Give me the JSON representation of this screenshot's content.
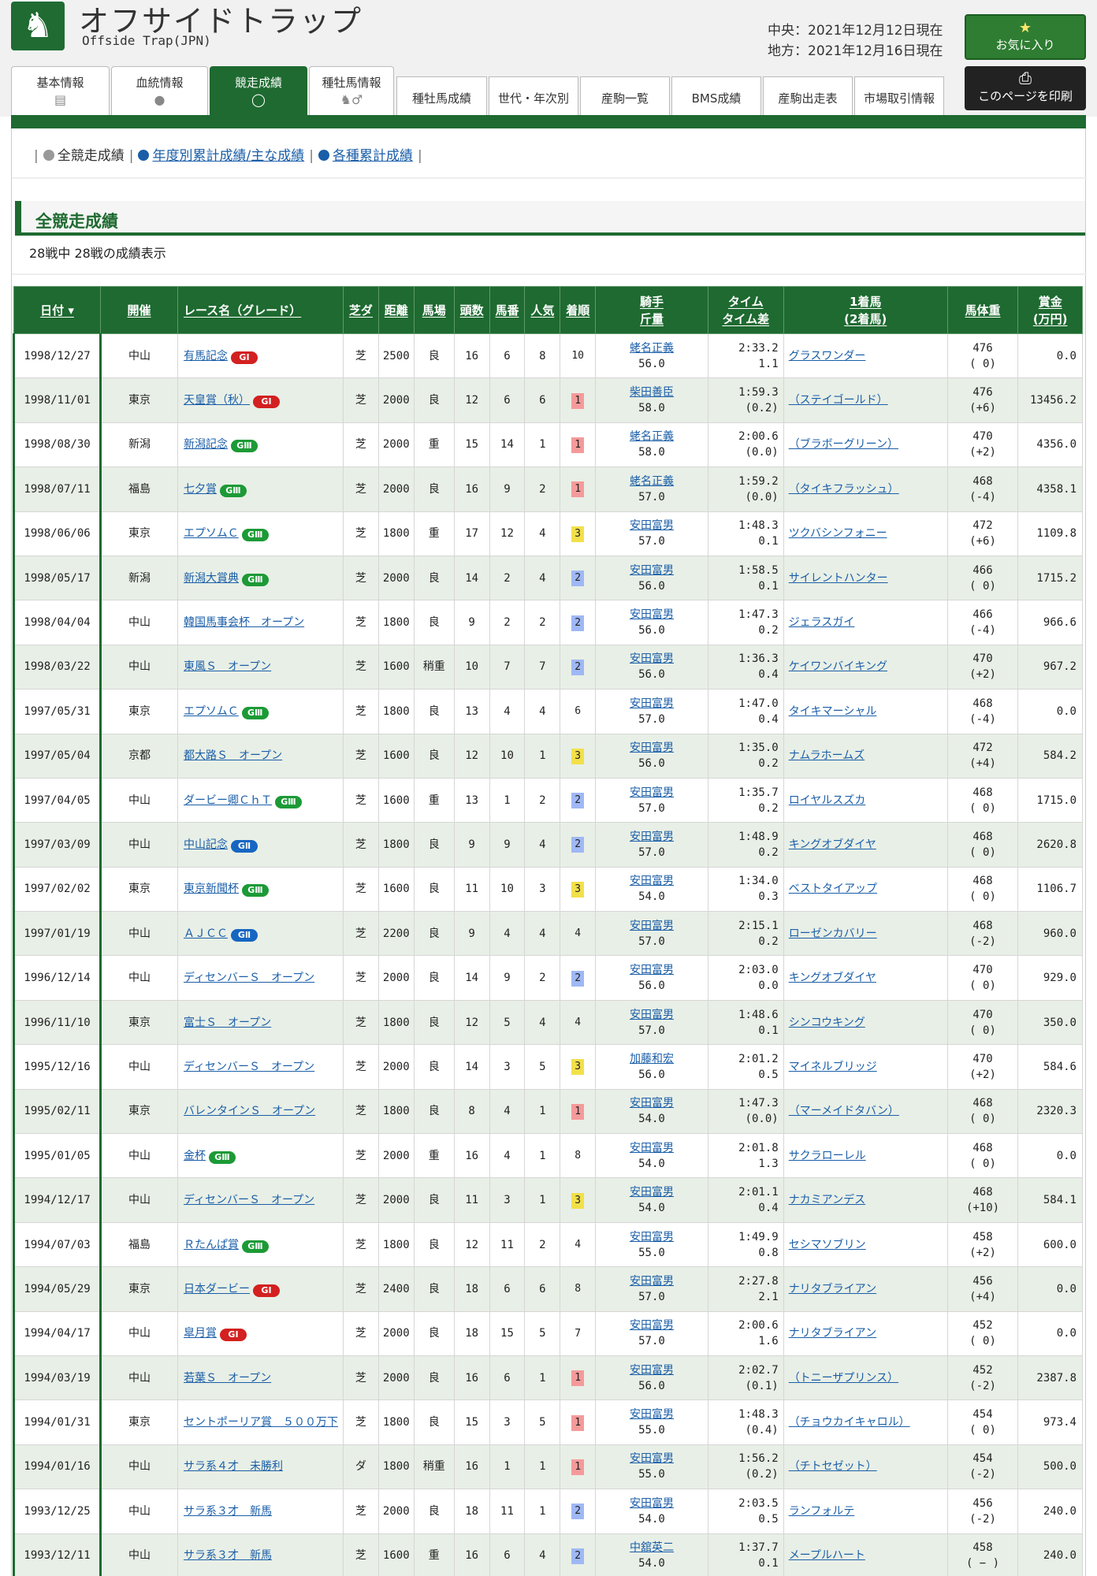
{
  "site": {
    "title": "オフサイドトラップ",
    "subtitle": "Offside Trap(JPN)",
    "date_central": "中央：2021年12月12日現在",
    "date_local": "地方：2021年12月16日現在",
    "fav_label": "お気に入り",
    "print_label": "このページを印刷",
    "logo_icon": "horse-icon"
  },
  "tabs": [
    {
      "label": "基本情報",
      "icon": "document-icon"
    },
    {
      "label": "血統情報",
      "icon": "drop-icon"
    },
    {
      "label": "競走成績",
      "icon": "horseshoe-icon",
      "active": true
    },
    {
      "label": "種牡馬情報",
      "icon": "horse-male-icon"
    }
  ],
  "subtabs": [
    "種牡馬成績",
    "世代・年次別",
    "産駒一覧",
    "BMS成績",
    "産駒出走表",
    "市場取引情報"
  ],
  "nav": {
    "current": "全競走成績",
    "link1": "年度別累計成績/主な成績",
    "link2": "各種累計成績"
  },
  "section": {
    "title": "全競走成績",
    "count": "28戦中 28戦の成績表示"
  },
  "columns": {
    "date": "日付",
    "venue": "開催",
    "race": "レース名（グレード）",
    "surface": "芝ダ",
    "distance": "距離",
    "going": "馬場",
    "runners": "頭数",
    "gate": "馬番",
    "pop": "人気",
    "place": "着順",
    "jockey1": "騎手",
    "jockey2": "斤量",
    "time1": "タイム",
    "time2": "タイム差",
    "winner1": "1着馬",
    "winner2": "(2着馬)",
    "weight": "馬体重",
    "prize1": "賞金",
    "prize2": "(万円)"
  },
  "rows": [
    {
      "date": "1998/12/27",
      "venue": "中山",
      "race": "有馬記念",
      "grade": "G1",
      "surface": "芝",
      "distance": "2500",
      "going": "良",
      "runners": "16",
      "gate": "6",
      "pop": "8",
      "place": "10",
      "jockey": "蛯名正義",
      "kinryo": "56.0",
      "time": "2:33.2",
      "diff": "1.1",
      "winner": "グラスワンダー",
      "bw": "476",
      "bwd": "( 0)",
      "prize": "0.0"
    },
    {
      "date": "1998/11/01",
      "venue": "東京",
      "race": "天皇賞（秋）",
      "grade": "G1",
      "surface": "芝",
      "distance": "2000",
      "going": "良",
      "runners": "12",
      "gate": "6",
      "pop": "6",
      "place": "1",
      "jockey": "柴田善臣",
      "kinryo": "58.0",
      "time": "1:59.3",
      "diff": "(0.2)",
      "winner": "（ステイゴールド）",
      "bw": "476",
      "bwd": "(+6)",
      "prize": "13456.2"
    },
    {
      "date": "1998/08/30",
      "venue": "新潟",
      "race": "新潟記念",
      "grade": "G3",
      "surface": "芝",
      "distance": "2000",
      "going": "重",
      "runners": "15",
      "gate": "14",
      "pop": "1",
      "place": "1",
      "jockey": "蛯名正義",
      "kinryo": "58.0",
      "time": "2:00.6",
      "diff": "(0.0)",
      "winner": "（ブラボーグリーン）",
      "bw": "470",
      "bwd": "(+2)",
      "prize": "4356.0"
    },
    {
      "date": "1998/07/11",
      "venue": "福島",
      "race": "七夕賞",
      "grade": "G3",
      "surface": "芝",
      "distance": "2000",
      "going": "良",
      "runners": "16",
      "gate": "9",
      "pop": "2",
      "place": "1",
      "jockey": "蛯名正義",
      "kinryo": "57.0",
      "time": "1:59.2",
      "diff": "(0.0)",
      "winner": "（タイキフラッシュ）",
      "bw": "468",
      "bwd": "(-4)",
      "prize": "4358.1"
    },
    {
      "date": "1998/06/06",
      "venue": "東京",
      "race": "エプソムＣ",
      "grade": "G3",
      "surface": "芝",
      "distance": "1800",
      "going": "重",
      "runners": "17",
      "gate": "12",
      "pop": "4",
      "place": "3",
      "jockey": "安田富男",
      "kinryo": "57.0",
      "time": "1:48.3",
      "diff": "0.1",
      "winner": "ツクバシンフォニー",
      "bw": "472",
      "bwd": "(+6)",
      "prize": "1109.8"
    },
    {
      "date": "1998/05/17",
      "venue": "新潟",
      "race": "新潟大賞典",
      "grade": "G3",
      "surface": "芝",
      "distance": "2000",
      "going": "良",
      "runners": "14",
      "gate": "2",
      "pop": "4",
      "place": "2",
      "jockey": "安田富男",
      "kinryo": "56.0",
      "time": "1:58.5",
      "diff": "0.1",
      "winner": "サイレントハンター",
      "bw": "466",
      "bwd": "( 0)",
      "prize": "1715.2"
    },
    {
      "date": "1998/04/04",
      "venue": "中山",
      "race": "韓国馬事会杯　オープン",
      "grade": "",
      "surface": "芝",
      "distance": "1800",
      "going": "良",
      "runners": "9",
      "gate": "2",
      "pop": "2",
      "place": "2",
      "jockey": "安田富男",
      "kinryo": "56.0",
      "time": "1:47.3",
      "diff": "0.2",
      "winner": "ジェラスガイ",
      "bw": "466",
      "bwd": "(-4)",
      "prize": "966.6"
    },
    {
      "date": "1998/03/22",
      "venue": "中山",
      "race": "東風Ｓ　オープン",
      "grade": "",
      "surface": "芝",
      "distance": "1600",
      "going": "稍重",
      "runners": "10",
      "gate": "7",
      "pop": "7",
      "place": "2",
      "jockey": "安田富男",
      "kinryo": "56.0",
      "time": "1:36.3",
      "diff": "0.4",
      "winner": "ケイワンバイキング",
      "bw": "470",
      "bwd": "(+2)",
      "prize": "967.2"
    },
    {
      "date": "1997/05/31",
      "venue": "東京",
      "race": "エプソムＣ",
      "grade": "G3",
      "surface": "芝",
      "distance": "1800",
      "going": "良",
      "runners": "13",
      "gate": "4",
      "pop": "4",
      "place": "6",
      "jockey": "安田富男",
      "kinryo": "57.0",
      "time": "1:47.0",
      "diff": "0.4",
      "winner": "タイキマーシャル",
      "bw": "468",
      "bwd": "(-4)",
      "prize": "0.0"
    },
    {
      "date": "1997/05/04",
      "venue": "京都",
      "race": "都大路Ｓ　オープン",
      "grade": "",
      "surface": "芝",
      "distance": "1600",
      "going": "良",
      "runners": "12",
      "gate": "10",
      "pop": "1",
      "place": "3",
      "jockey": "安田富男",
      "kinryo": "56.0",
      "time": "1:35.0",
      "diff": "0.2",
      "winner": "ナムラホームズ",
      "bw": "472",
      "bwd": "(+4)",
      "prize": "584.2"
    },
    {
      "date": "1997/04/05",
      "venue": "中山",
      "race": "ダービー卿ＣｈＴ",
      "grade": "G3",
      "surface": "芝",
      "distance": "1600",
      "going": "重",
      "runners": "13",
      "gate": "1",
      "pop": "2",
      "place": "2",
      "jockey": "安田富男",
      "kinryo": "57.0",
      "time": "1:35.7",
      "diff": "0.2",
      "winner": "ロイヤルスズカ",
      "bw": "468",
      "bwd": "( 0)",
      "prize": "1715.0"
    },
    {
      "date": "1997/03/09",
      "venue": "中山",
      "race": "中山記念",
      "grade": "G2",
      "surface": "芝",
      "distance": "1800",
      "going": "良",
      "runners": "9",
      "gate": "9",
      "pop": "4",
      "place": "2",
      "jockey": "安田富男",
      "kinryo": "57.0",
      "time": "1:48.9",
      "diff": "0.2",
      "winner": "キングオブダイヤ",
      "bw": "468",
      "bwd": "( 0)",
      "prize": "2620.8"
    },
    {
      "date": "1997/02/02",
      "venue": "東京",
      "race": "東京新聞杯",
      "grade": "G3",
      "surface": "芝",
      "distance": "1600",
      "going": "良",
      "runners": "11",
      "gate": "10",
      "pop": "3",
      "place": "3",
      "jockey": "安田富男",
      "kinryo": "54.0",
      "time": "1:34.0",
      "diff": "0.3",
      "winner": "ベストタイアップ",
      "bw": "468",
      "bwd": "( 0)",
      "prize": "1106.7"
    },
    {
      "date": "1997/01/19",
      "venue": "中山",
      "race": "ＡＪＣＣ",
      "grade": "G2",
      "surface": "芝",
      "distance": "2200",
      "going": "良",
      "runners": "9",
      "gate": "4",
      "pop": "4",
      "place": "4",
      "jockey": "安田富男",
      "kinryo": "57.0",
      "time": "2:15.1",
      "diff": "0.2",
      "winner": "ローゼンカバリー",
      "bw": "468",
      "bwd": "(-2)",
      "prize": "960.0"
    },
    {
      "date": "1996/12/14",
      "venue": "中山",
      "race": "ディセンバーＳ　オープン",
      "grade": "",
      "surface": "芝",
      "distance": "2000",
      "going": "良",
      "runners": "14",
      "gate": "9",
      "pop": "2",
      "place": "2",
      "jockey": "安田富男",
      "kinryo": "56.0",
      "time": "2:03.0",
      "diff": "0.0",
      "winner": "キングオブダイヤ",
      "bw": "470",
      "bwd": "( 0)",
      "prize": "929.0"
    },
    {
      "date": "1996/11/10",
      "venue": "東京",
      "race": "富士Ｓ　オープン",
      "grade": "",
      "surface": "芝",
      "distance": "1800",
      "going": "良",
      "runners": "12",
      "gate": "5",
      "pop": "4",
      "place": "4",
      "jockey": "安田富男",
      "kinryo": "57.0",
      "time": "1:48.6",
      "diff": "0.1",
      "winner": "シンコウキング",
      "bw": "470",
      "bwd": "( 0)",
      "prize": "350.0"
    },
    {
      "date": "1995/12/16",
      "venue": "中山",
      "race": "ディセンバーＳ　オープン",
      "grade": "",
      "surface": "芝",
      "distance": "2000",
      "going": "良",
      "runners": "14",
      "gate": "3",
      "pop": "5",
      "place": "3",
      "jockey": "加藤和宏",
      "kinryo": "56.0",
      "time": "2:01.2",
      "diff": "0.5",
      "winner": "マイネルブリッジ",
      "bw": "470",
      "bwd": "(+2)",
      "prize": "584.6"
    },
    {
      "date": "1995/02/11",
      "venue": "東京",
      "race": "バレンタインＳ　オープン",
      "grade": "",
      "surface": "芝",
      "distance": "1800",
      "going": "良",
      "runners": "8",
      "gate": "4",
      "pop": "1",
      "place": "1",
      "jockey": "安田富男",
      "kinryo": "54.0",
      "time": "1:47.3",
      "diff": "(0.0)",
      "winner": "（マーメイドタバン）",
      "bw": "468",
      "bwd": "( 0)",
      "prize": "2320.3"
    },
    {
      "date": "1995/01/05",
      "venue": "中山",
      "race": "金杯",
      "grade": "G3",
      "surface": "芝",
      "distance": "2000",
      "going": "重",
      "runners": "16",
      "gate": "4",
      "pop": "1",
      "place": "8",
      "jockey": "安田富男",
      "kinryo": "54.0",
      "time": "2:01.8",
      "diff": "1.3",
      "winner": "サクラローレル",
      "bw": "468",
      "bwd": "( 0)",
      "prize": "0.0"
    },
    {
      "date": "1994/12/17",
      "venue": "中山",
      "race": "ディセンバーＳ　オープン",
      "grade": "",
      "surface": "芝",
      "distance": "2000",
      "going": "良",
      "runners": "11",
      "gate": "3",
      "pop": "1",
      "place": "3",
      "jockey": "安田富男",
      "kinryo": "54.0",
      "time": "2:01.1",
      "diff": "0.4",
      "winner": "ナカミアンデス",
      "bw": "468",
      "bwd": "(+10)",
      "prize": "584.1"
    },
    {
      "date": "1994/07/03",
      "venue": "福島",
      "race": "Ｒたんぱ賞",
      "grade": "G3",
      "surface": "芝",
      "distance": "1800",
      "going": "良",
      "runners": "12",
      "gate": "11",
      "pop": "2",
      "place": "4",
      "jockey": "安田富男",
      "kinryo": "55.0",
      "time": "1:49.9",
      "diff": "0.8",
      "winner": "セシマソブリン",
      "bw": "458",
      "bwd": "(+2)",
      "prize": "600.0"
    },
    {
      "date": "1994/05/29",
      "venue": "東京",
      "race": "日本ダービー",
      "grade": "G1",
      "surface": "芝",
      "distance": "2400",
      "going": "良",
      "runners": "18",
      "gate": "6",
      "pop": "6",
      "place": "8",
      "jockey": "安田富男",
      "kinryo": "57.0",
      "time": "2:27.8",
      "diff": "2.1",
      "winner": "ナリタブライアン",
      "bw": "456",
      "bwd": "(+4)",
      "prize": "0.0"
    },
    {
      "date": "1994/04/17",
      "venue": "中山",
      "race": "皐月賞",
      "grade": "G1",
      "surface": "芝",
      "distance": "2000",
      "going": "良",
      "runners": "18",
      "gate": "15",
      "pop": "5",
      "place": "7",
      "jockey": "安田富男",
      "kinryo": "57.0",
      "time": "2:00.6",
      "diff": "1.6",
      "winner": "ナリタブライアン",
      "bw": "452",
      "bwd": "( 0)",
      "prize": "0.0"
    },
    {
      "date": "1994/03/19",
      "venue": "中山",
      "race": "若葉Ｓ　オープン",
      "grade": "",
      "surface": "芝",
      "distance": "2000",
      "going": "良",
      "runners": "16",
      "gate": "6",
      "pop": "1",
      "place": "1",
      "jockey": "安田富男",
      "kinryo": "56.0",
      "time": "2:02.7",
      "diff": "(0.1)",
      "winner": "（トニーザプリンス）",
      "bw": "452",
      "bwd": "(-2)",
      "prize": "2387.8"
    },
    {
      "date": "1994/01/31",
      "venue": "東京",
      "race": "セントポーリア賞　５００万下",
      "grade": "",
      "surface": "芝",
      "distance": "1800",
      "going": "良",
      "runners": "15",
      "gate": "3",
      "pop": "5",
      "place": "1",
      "jockey": "安田富男",
      "kinryo": "55.0",
      "time": "1:48.3",
      "diff": "(0.4)",
      "winner": "（チョウカイキャロル）",
      "bw": "454",
      "bwd": "( 0)",
      "prize": "973.4"
    },
    {
      "date": "1994/01/16",
      "venue": "中山",
      "race": "サラ系４才　未勝利",
      "grade": "",
      "surface": "ダ",
      "distance": "1800",
      "going": "稍重",
      "runners": "16",
      "gate": "1",
      "pop": "1",
      "place": "1",
      "jockey": "安田富男",
      "kinryo": "55.0",
      "time": "1:56.2",
      "diff": "(0.2)",
      "winner": "（チトセゼット）",
      "bw": "454",
      "bwd": "(-2)",
      "prize": "500.0"
    },
    {
      "date": "1993/12/25",
      "venue": "中山",
      "race": "サラ系３才　新馬",
      "grade": "",
      "surface": "芝",
      "distance": "2000",
      "going": "良",
      "runners": "18",
      "gate": "11",
      "pop": "1",
      "place": "2",
      "jockey": "安田富男",
      "kinryo": "54.0",
      "time": "2:03.5",
      "diff": "0.5",
      "winner": "ランフォルテ",
      "bw": "456",
      "bwd": "(-2)",
      "prize": "240.0"
    },
    {
      "date": "1993/12/11",
      "venue": "中山",
      "race": "サラ系３才　新馬",
      "grade": "",
      "surface": "芝",
      "distance": "1600",
      "going": "重",
      "runners": "16",
      "gate": "6",
      "pop": "4",
      "place": "2",
      "jockey": "中舘英二",
      "kinryo": "54.0",
      "time": "1:37.7",
      "diff": "0.1",
      "winner": "メープルハート",
      "bw": "458",
      "bwd": "( − )",
      "prize": "240.0"
    }
  ],
  "grade_labels": {
    "G1": "GⅠ",
    "G2": "GⅡ",
    "G3": "GⅢ"
  }
}
